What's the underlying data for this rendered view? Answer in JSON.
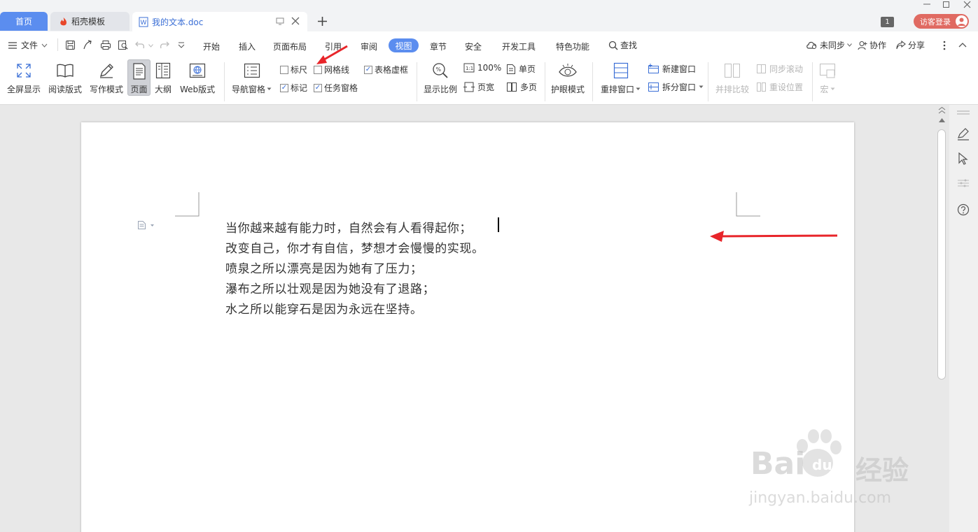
{
  "tabs": {
    "home": "首页",
    "templates": "稻壳模板",
    "doc": "我的文本.doc",
    "count_badge": "1",
    "login": "访客登录"
  },
  "menubar": {
    "file": "文件",
    "items": [
      "开始",
      "插入",
      "页面布局",
      "引用",
      "审阅",
      "视图",
      "章节",
      "安全",
      "开发工具",
      "特色功能"
    ],
    "search": "查找",
    "sync": "未同步",
    "collab": "协作",
    "share": "分享"
  },
  "ribbon": {
    "fullscreen": "全屏显示",
    "read_mode": "阅读版式",
    "write_mode": "写作模式",
    "page": "页面",
    "outline": "大纲",
    "web": "Web版式",
    "nav_pane": "导航窗格",
    "ruler": "标尺",
    "gridlines": "网格线",
    "table_frame": "表格虚框",
    "marks": "标记",
    "task_pane": "任务窗格",
    "zoom_ratio": "显示比例",
    "zoom_100": "100%",
    "page_width": "页宽",
    "single_page": "单页",
    "multi_page": "多页",
    "eye_mode": "护眼模式",
    "rearrange": "重排窗口",
    "new_window": "新建窗口",
    "split_window": "拆分窗口",
    "side_by_side": "并排比较",
    "sync_scroll": "同步滚动",
    "reset_pos": "重设位置",
    "macro": "宏"
  },
  "checkboxes": {
    "ruler": false,
    "gridlines": false,
    "table_frame": true,
    "marks": true,
    "task_pane": true
  },
  "document": {
    "lines": [
      "当你越来越有能力时，自然会有人看得起你；",
      "改变自己，你才有自信，梦想才会慢慢的实现。",
      "喷泉之所以漂亮是因为她有了压力；",
      "瀑布之所以壮观是因为她没有了退路；",
      "水之所以能穿石是因为永远在坚持。"
    ]
  },
  "watermark": {
    "brand": "Bai",
    "brand2": "du",
    "cn": "经验",
    "url": "jingyan.baidu.com"
  },
  "colors": {
    "accent": "#5b8def",
    "annotation": "#e8252a"
  }
}
